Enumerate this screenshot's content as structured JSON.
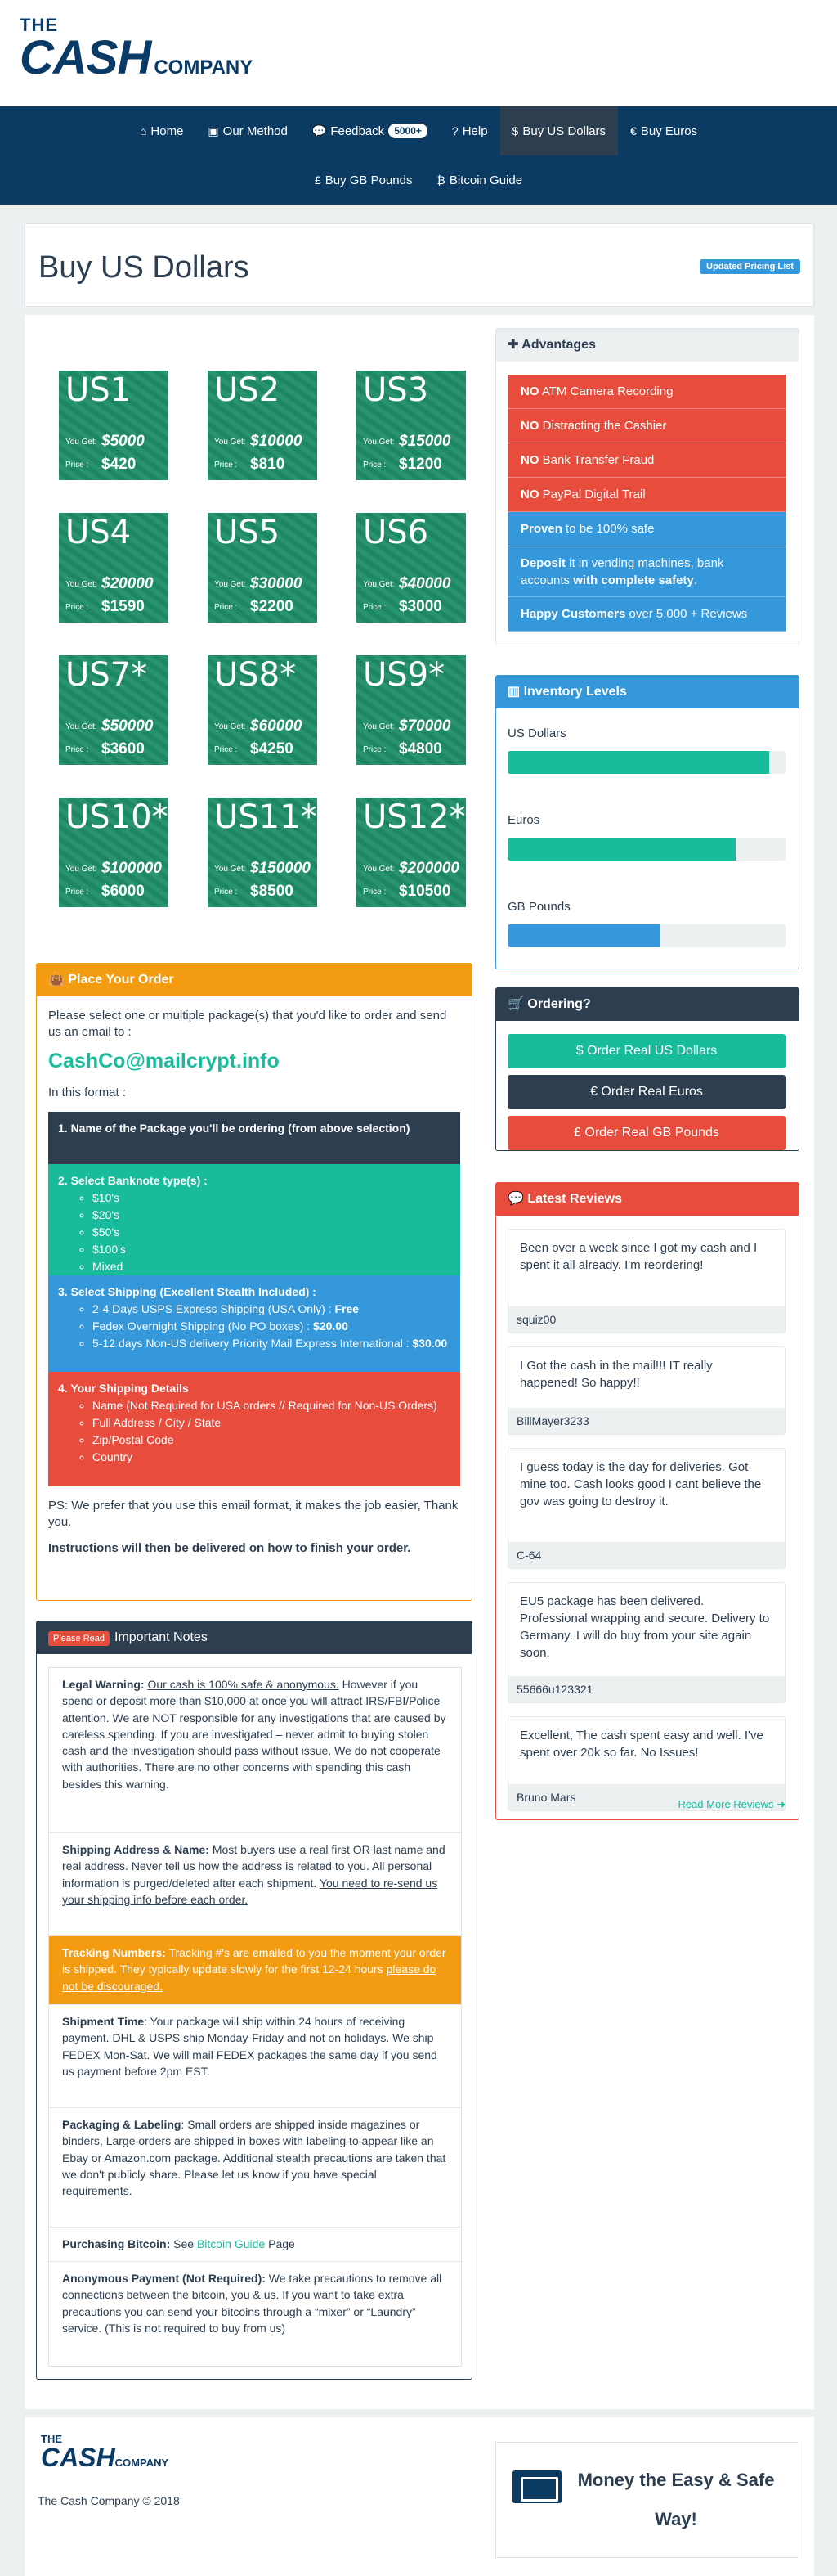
{
  "header": {
    "logo_the": "THE",
    "logo_cash": "CASH",
    "logo_company": "COMPANY"
  },
  "nav": {
    "row1": [
      {
        "icon": "⌂",
        "label": "Home",
        "name": "nav-home"
      },
      {
        "icon": "▣",
        "label": "Our Method",
        "name": "nav-our-method"
      },
      {
        "icon": "💬",
        "label": "Feedback",
        "name": "nav-feedback",
        "badge": "5000+"
      },
      {
        "icon": "?",
        "label": "Help",
        "name": "nav-help"
      },
      {
        "icon": "$",
        "label": "Buy US Dollars",
        "name": "nav-buy-us-dollars",
        "active": true
      },
      {
        "icon": "€",
        "label": "Buy Euros",
        "name": "nav-buy-euros"
      }
    ],
    "row2": [
      {
        "icon": "£",
        "label": "Buy GB Pounds",
        "name": "nav-buy-gb-pounds"
      },
      {
        "icon": "₿",
        "label": "Bitcoin Guide",
        "name": "nav-bitcoin-guide"
      }
    ]
  },
  "page": {
    "title": "Buy US Dollars",
    "pricing_pill": "Updated Pricing List"
  },
  "packages": [
    {
      "name": "US1",
      "get": "$5000",
      "price": "$420"
    },
    {
      "name": "US2",
      "get": "$10000",
      "price": "$810"
    },
    {
      "name": "US3",
      "get": "$15000",
      "price": "$1200"
    },
    {
      "name": "US4",
      "get": "$20000",
      "price": "$1590"
    },
    {
      "name": "US5",
      "get": "$30000",
      "price": "$2200"
    },
    {
      "name": "US6",
      "get": "$40000",
      "price": "$3000"
    },
    {
      "name": "US7*",
      "get": "$50000",
      "price": "$3600"
    },
    {
      "name": "US8*",
      "get": "$60000",
      "price": "$4250"
    },
    {
      "name": "US9*",
      "get": "$70000",
      "price": "$4800"
    },
    {
      "name": "US10*",
      "get": "$100000",
      "price": "$6000"
    },
    {
      "name": "US11*",
      "get": "$150000",
      "price": "$8500"
    },
    {
      "name": "US12*",
      "get": "$200000",
      "price": "$10500"
    }
  ],
  "package_labels": {
    "get": "You Get:",
    "price": "Price :"
  },
  "order": {
    "title": "Place Your Order",
    "intro": "Please select one or multiple package(s) that you'd like to order and send us an email to :",
    "email": "CashCo@mailcrypt.info",
    "format": "In this format :",
    "step1": "1. Name of the Package you'll be ordering (from above selection)",
    "step2": "2. Select Banknote type(s) :",
    "banknotes": [
      "$10's",
      "$20's",
      "$50's",
      "$100's",
      "Mixed"
    ],
    "step3": "3. Select Shipping (Excellent Stealth Included) :",
    "ship1": "2-4 Days USPS Express Shipping (USA Only) : ",
    "ship1_price": "Free",
    "ship2": "Fedex Overnight Shipping (No PO boxes) : ",
    "ship2_price": "$20.00",
    "ship3": "5-12 days Non-US delivery Priority Mail Express International : ",
    "ship3_price": "$30.00",
    "step4": "4. Your Shipping Details",
    "details": [
      "Name (Not Required for USA orders // Required for Non-US Orders)",
      "Full Address / City / State",
      "Zip/Postal Code",
      "Country"
    ],
    "ps": "PS: We prefer that you use this email format, it makes the job easier, Thank you.",
    "instructions": "Instructions will then be delivered on how to finish your order."
  },
  "notes": {
    "read_pill": "Please Read",
    "title": "Important Notes",
    "legal_h": "Legal Warning:",
    "legal_u": "Our cash is 100% safe & anonymous.",
    "legal": " However if you spend or deposit more than $10,000 at once you will attract IRS/FBI/Police attention.  We are NOT responsible for any investigations that are caused by careless spending.  If you are investigated – never admit to buying stolen cash and the investigation should pass without issue.  We do not cooperate with authorities.  There are no other concerns with spending this cash besides this warning.",
    "ship_h": "Shipping Address & Name:",
    "ship": " Most buyers use a real first OR last name and real address.   Never tell us how the address is related to you.  All personal information is purged/deleted after each shipment. ",
    "ship_u": "You need to re-send us your shipping info before each order.",
    "track_h": "Tracking Numbers:",
    "track": " Tracking #'s are emailed to you the moment your order is shipped. They typically update slowly for the first 12-24 hours ",
    "track_u": "please do not be discouraged.",
    "time_h": "Shipment Time",
    "time": ": Your package will ship within 24 hours of receiving payment.  DHL & USPS ship Monday-Friday and not on holidays. We ship FEDEX Mon-Sat.  We will mail FEDEX packages the same day if you send us payment before 2pm EST.",
    "pack_h": "Packaging & Labeling",
    "pack": ": Small orders are shipped inside magazines or binders, Large orders are shipped in boxes with labeling to appear like an Ebay or Amazon.com package. Additional stealth precautions are taken that we don't publicly share.  Please let us know if you have special requirements.",
    "btc_h": "Purchasing Bitcoin:",
    "btc_pre": " See ",
    "btc_link": "Bitcoin Guide",
    "btc_post": " Page",
    "anon_h": "Anonymous Payment (Not Required):",
    "anon": "  We take precautions to remove all connections between the bitcoin, you & us. If you want to take extra precautions you can send your bitcoins through a “mixer” or “Laundry” service.  (This is not required to buy from us)"
  },
  "advantages": {
    "title": "Advantages",
    "items": [
      {
        "b": "NO",
        "t": " ATM Camera Recording",
        "c": "red"
      },
      {
        "b": "NO",
        "t": " Distracting the Cashier",
        "c": "red"
      },
      {
        "b": "NO",
        "t": " Bank Transfer Fraud",
        "c": "red"
      },
      {
        "b": "NO",
        "t": " PayPal Digital Trail",
        "c": "red"
      },
      {
        "b": "Proven",
        "t": " to be 100% safe",
        "c": "blue"
      },
      {
        "b": "Deposit",
        "t": " it in vending machines, bank accounts ",
        "b2": "with complete safety",
        "t2": ".",
        "c": "blue",
        "tall": true
      },
      {
        "b": "Happy Customers",
        "t": " over 5,000 + Reviews",
        "c": "blue"
      }
    ]
  },
  "inventory": {
    "title": "Inventory Levels",
    "items": [
      {
        "label": "US Dollars",
        "level": 0.94,
        "color": "#18bc9c"
      },
      {
        "label": "Euros",
        "level": 0.82,
        "color": "#18bc9c"
      },
      {
        "label": "GB Pounds",
        "level": 0.55,
        "color": "#3498db"
      }
    ]
  },
  "ordering": {
    "title": "Ordering?",
    "buttons": [
      {
        "label": "$ Order Real US Dollars",
        "color": "#18bc9c",
        "name": "order-us-dollars-button"
      },
      {
        "label": "€ Order Real Euros",
        "color": "#2c3e50",
        "name": "order-euros-button"
      },
      {
        "label": "£ Order Real GB Pounds",
        "color": "#e74c3c",
        "name": "order-gb-pounds-button"
      }
    ]
  },
  "reviews": {
    "title": "Latest Reviews",
    "items": [
      {
        "text": "Been over a week since I got my cash and I spent it all already. I'm reordering!",
        "author": "squiz00"
      },
      {
        "text": "I Got the cash in the mail!!! IT really happened! So happy!!",
        "author": "BillMayer3233"
      },
      {
        "text": "I guess today is the day for deliveries. Got mine too. Cash looks good I cant believe the gov was going to destroy it.",
        "author": "C-64"
      },
      {
        "text": "EU5 package has been delivered. Professional wrapping and secure. Delivery to Germany. I will do buy from your site again soon.",
        "author": "55666u123321"
      },
      {
        "text": "Excellent, The cash spent easy and well. I've spent over 20k so far. No Issues!",
        "author": "Bruno Mars"
      }
    ],
    "more": "Read More Reviews ➜"
  },
  "footer": {
    "copyright": "The Cash Company © 2018",
    "slogan": "Money the Easy & Safe Way!"
  }
}
